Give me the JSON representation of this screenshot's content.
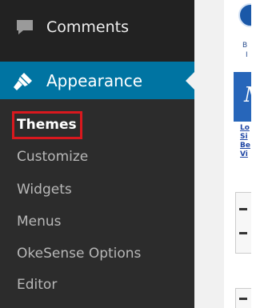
{
  "sidebar": {
    "comments": {
      "label": "Comments",
      "icon": "speech-bubble-icon"
    },
    "appearance": {
      "label": "Appearance",
      "icon": "paintbrush-icon"
    },
    "submenu": [
      {
        "label": "Themes",
        "active": true
      },
      {
        "label": "Customize"
      },
      {
        "label": "Widgets"
      },
      {
        "label": "Menus"
      },
      {
        "label": "OkeSense Options"
      },
      {
        "label": "Editor"
      }
    ]
  },
  "preview": {
    "header_text_1": "B",
    "header_text_2": "I",
    "banner_letter": "M",
    "links": [
      "Lo",
      "Si",
      "Be",
      "Vi"
    ]
  },
  "colors": {
    "sidebar_bg": "#222222",
    "submenu_bg": "#2c2c2c",
    "active_bg": "#0074a2",
    "highlight_border": "#d9181e"
  }
}
